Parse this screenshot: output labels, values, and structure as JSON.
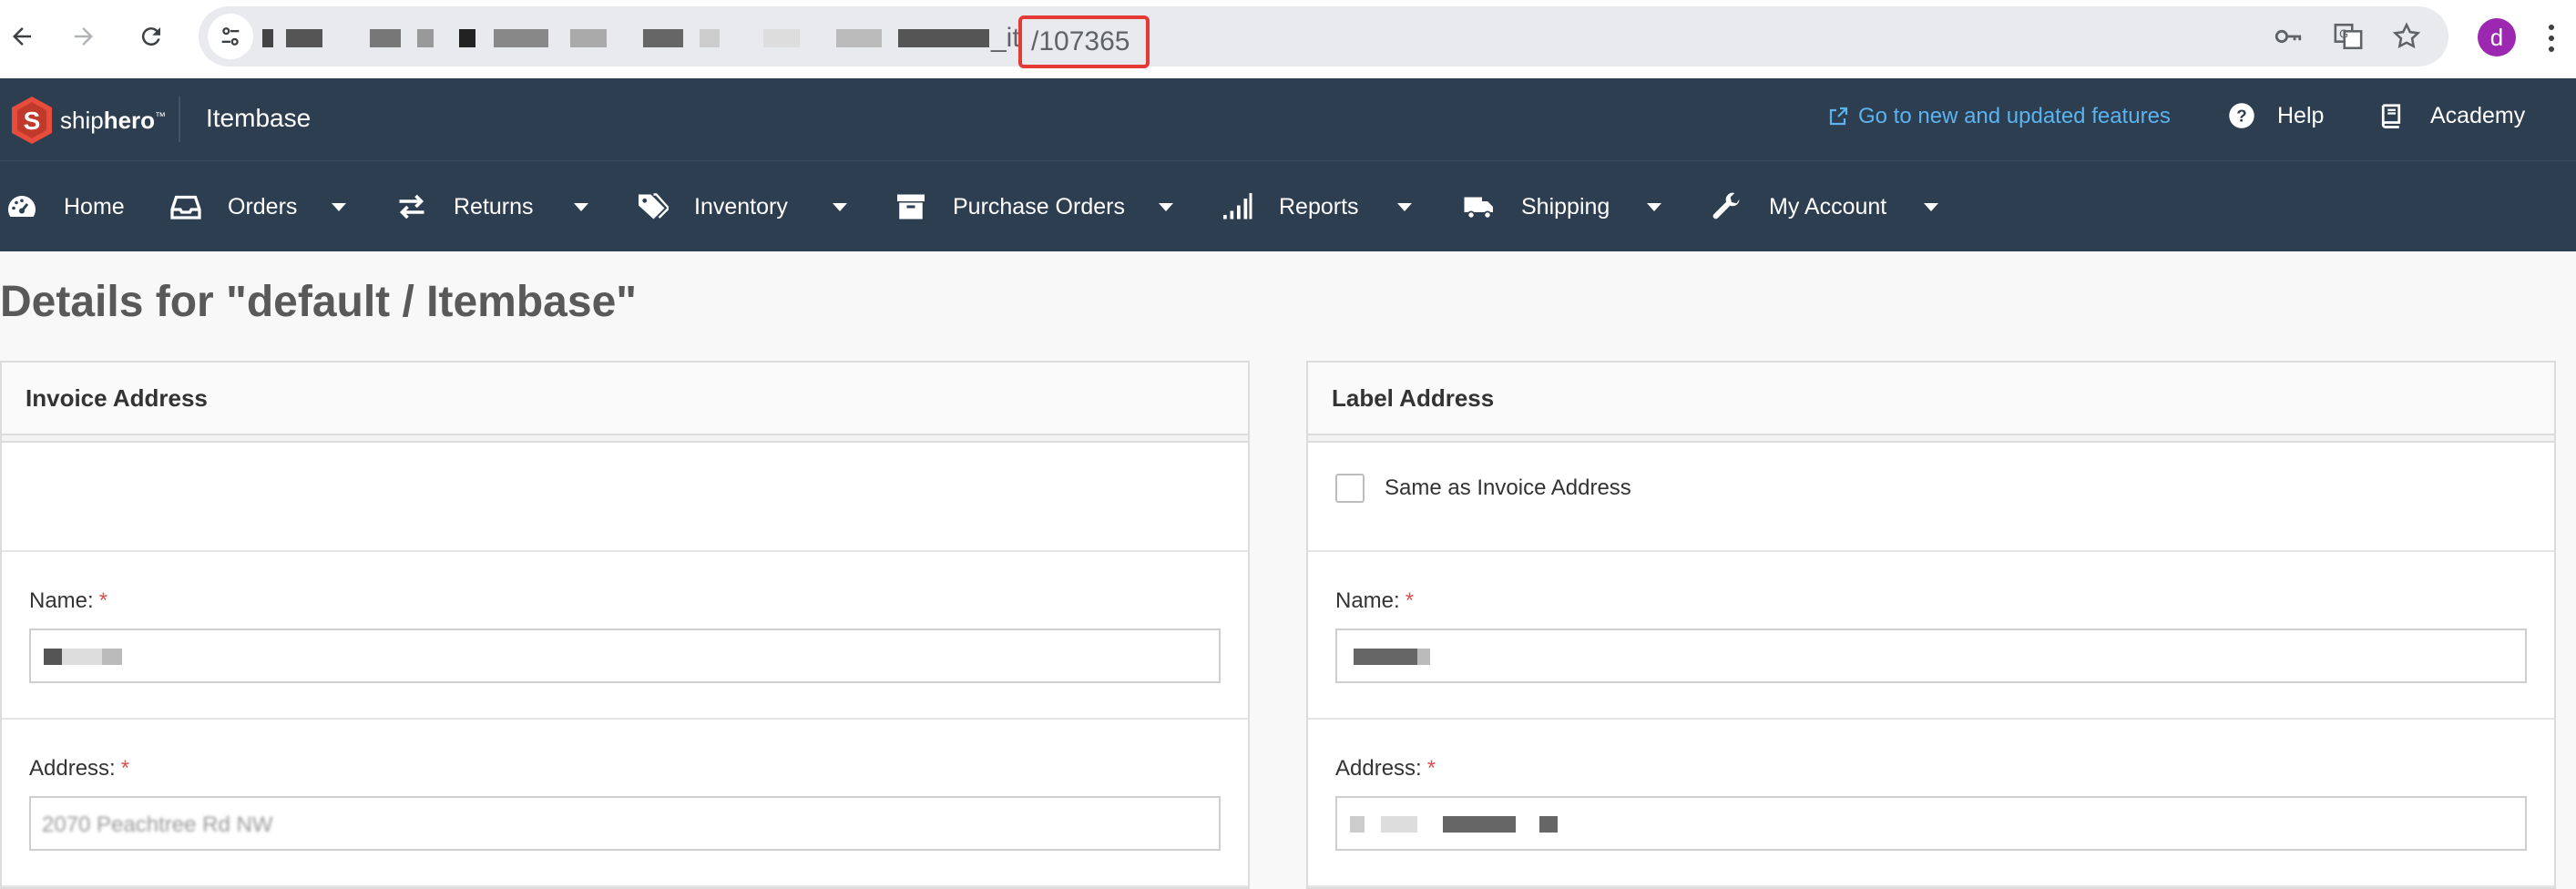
{
  "browser": {
    "url_tail": "_it",
    "url_id": "/107365",
    "avatar_letter": "d"
  },
  "header": {
    "logo_text_light": "ship",
    "logo_text_bold": "hero",
    "logo_tm": "™",
    "app_name": "Itembase",
    "features_link": "Go to new and updated features",
    "help": "Help",
    "academy": "Academy"
  },
  "nav": {
    "items": [
      {
        "label": "Home",
        "icon": "dashboard-icon"
      },
      {
        "label": "Orders",
        "icon": "inbox-icon"
      },
      {
        "label": "Returns",
        "icon": "exchange-icon"
      },
      {
        "label": "Inventory",
        "icon": "tags-icon"
      },
      {
        "label": "Purchase Orders",
        "icon": "archive-icon"
      },
      {
        "label": "Reports",
        "icon": "signal-icon"
      },
      {
        "label": "Shipping",
        "icon": "truck-icon"
      },
      {
        "label": "My Account",
        "icon": "wrench-icon"
      }
    ]
  },
  "page": {
    "title": "Details for \"default / Itembase\""
  },
  "invoice": {
    "title": "Invoice Address",
    "name_label": "Name:",
    "address_label": "Address:",
    "address_value": "2070 Peachtree Rd NW"
  },
  "label_address": {
    "title": "Label Address",
    "same_as_label": "Same as Invoice Address",
    "name_label": "Name:",
    "address_label": "Address:"
  },
  "required_mark": "*",
  "colors": {
    "header_bg": "#2d3e50",
    "link_blue": "#5bb3f0",
    "required_red": "#d9534f",
    "highlight_red": "#e53935",
    "avatar_purple": "#9c27b0"
  }
}
